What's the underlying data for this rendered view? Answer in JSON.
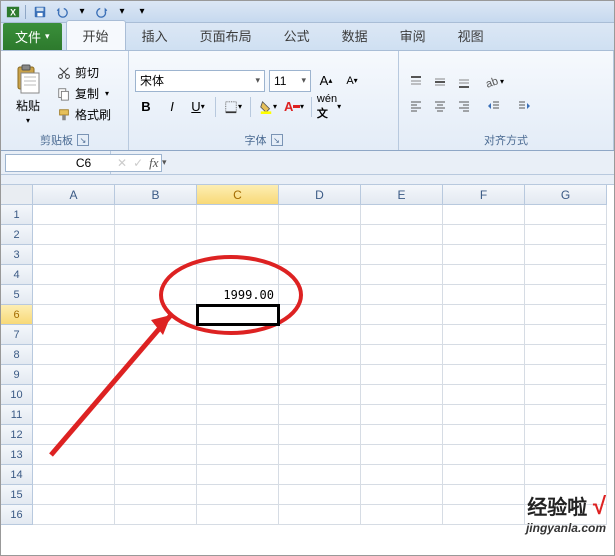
{
  "qat": {
    "app_icon": "excel"
  },
  "tabs": {
    "file": "文件",
    "items": [
      "开始",
      "插入",
      "页面布局",
      "公式",
      "数据",
      "审阅",
      "视图"
    ],
    "active_index": 0
  },
  "clipboard": {
    "group_label": "剪贴板",
    "paste_label": "粘贴",
    "cut_label": "剪切",
    "copy_label": "复制",
    "painter_label": "格式刷"
  },
  "font": {
    "group_label": "字体",
    "name": "宋体",
    "size": "11"
  },
  "alignment": {
    "group_label": "对齐方式"
  },
  "namebox": "C6",
  "formula": "",
  "grid": {
    "columns": [
      "A",
      "B",
      "C",
      "D",
      "E",
      "F",
      "G"
    ],
    "sel_col_index": 2,
    "row_count": 16,
    "sel_row": 6,
    "cells": {
      "C5": "1999.00"
    },
    "active_cell": "C6"
  },
  "watermark": {
    "brand": "经验啦",
    "check": "√",
    "url": "jingyanla.com"
  },
  "chart_data": null
}
